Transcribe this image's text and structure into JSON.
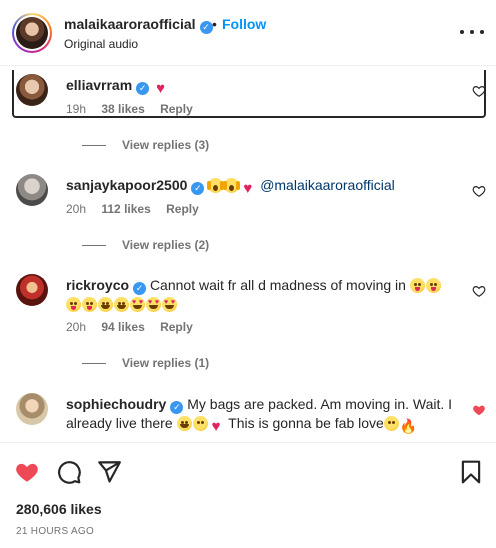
{
  "header": {
    "username": "malaikaaroraofficial",
    "separator": "•",
    "follow_label": "Follow",
    "audio_label": "Original audio",
    "verified_mark": "✓"
  },
  "comments": [
    {
      "username": "elliavrram",
      "text": "",
      "time": "19h",
      "likes": "38 likes",
      "reply": "Reply",
      "view_replies": "View replies (3)",
      "liked": false
    },
    {
      "username": "sanjaykapoor2500",
      "mention": "@malaikaaroraofficial",
      "time": "20h",
      "likes": "112 likes",
      "reply": "Reply",
      "view_replies": "View replies (2)",
      "liked": false
    },
    {
      "username": "rickroyco",
      "text": "Cannot wait fr all d madness of moving in",
      "time": "20h",
      "likes": "94 likes",
      "reply": "Reply",
      "view_replies": "View replies (1)",
      "liked": false
    },
    {
      "username": "sophiechoudry",
      "text_part1": "My bags are packed. Am moving in. Wait. I already live there",
      "text_part2": "This is gonna be fab love",
      "liked": true
    }
  ],
  "post": {
    "likes_count": "280,606 likes",
    "time_ago": "21 HOURS AGO"
  },
  "icons": {
    "like": "heart-icon",
    "comment": "comment-bubble-icon",
    "share": "paper-plane-icon",
    "save": "bookmark-icon",
    "more": "more-dots-icon"
  },
  "colors": {
    "follow": "#0095f6",
    "verified": "#3897f0",
    "liked_heart": "#ed4956",
    "text": "#262626",
    "muted": "#737373"
  }
}
